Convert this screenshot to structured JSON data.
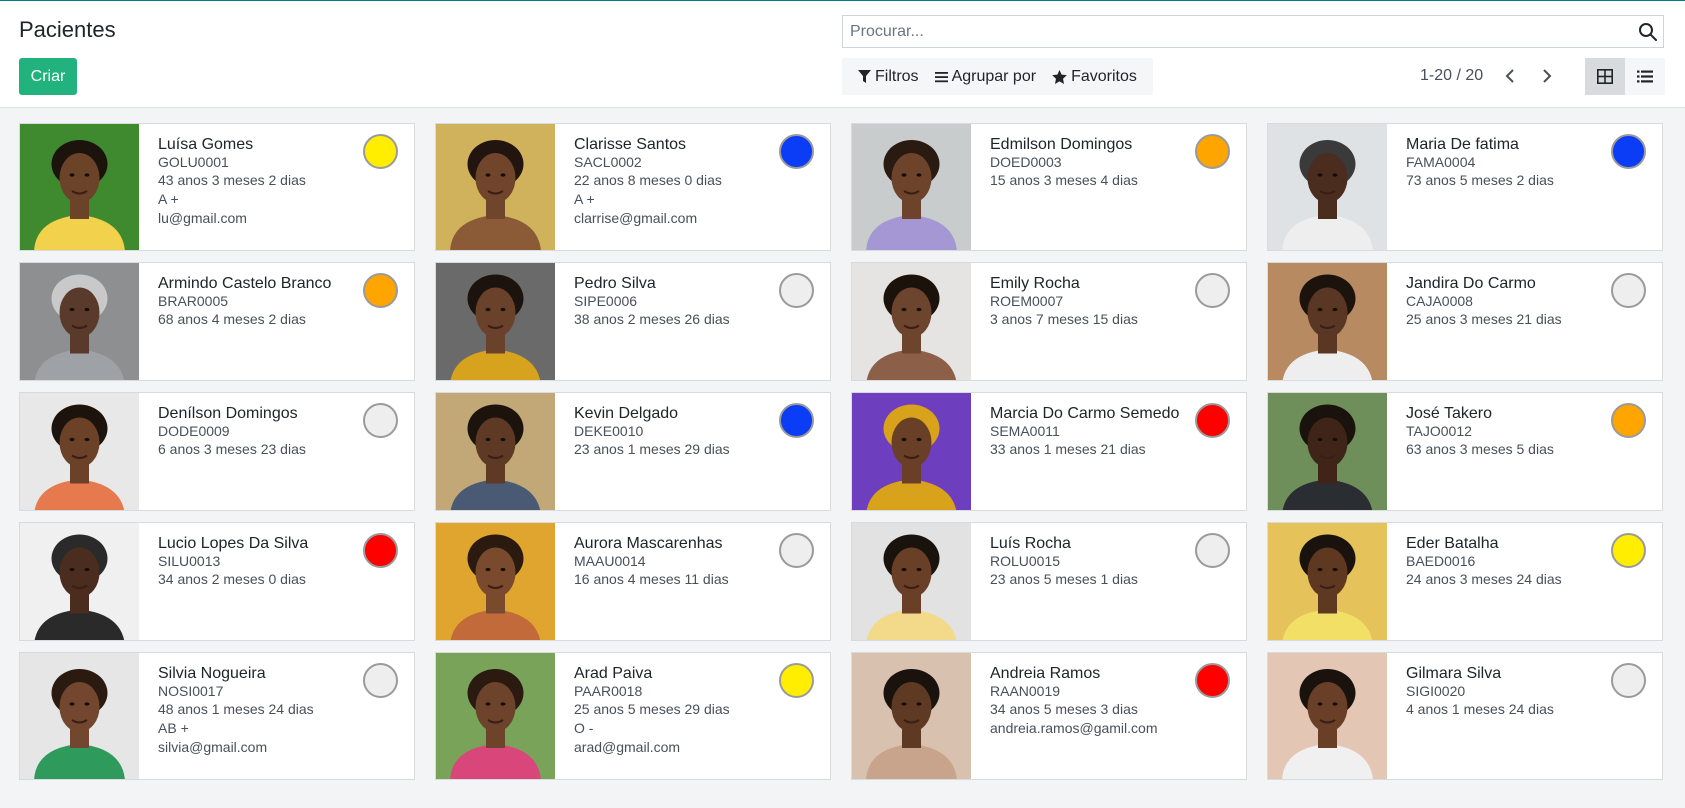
{
  "header": {
    "title": "Pacientes",
    "create_label": "Criar",
    "search_placeholder": "Procurar...",
    "filters_label": "Filtros",
    "group_label": "Agrupar por",
    "favorites_label": "Favoritos",
    "pager": "1-20 / 20",
    "view_modes": [
      "kanban",
      "list"
    ],
    "active_view": "kanban"
  },
  "colors": {
    "accent": "#21b27d",
    "topline": "#017e84",
    "dot_empty": "#eeeeee",
    "dot_yellow": "#ffee00",
    "dot_blue": "#0a3df5",
    "dot_orange": "#ffa500",
    "dot_red": "#ff0000"
  },
  "patients": [
    {
      "name": "Luísa Gomes",
      "code": "GOLU0001",
      "age": "43 anos 3 meses 2 dias",
      "blood": "A +",
      "email": "lu@gmail.com",
      "dot": "#ffee00",
      "skin": "#6b4328",
      "bg": "#3f8a2e",
      "shirt": "#f2d14c",
      "hair": "#1c130d"
    },
    {
      "name": "Clarisse Santos",
      "code": "SACL0002",
      "age": "22 anos 8 meses 0 dias",
      "blood": "A +",
      "email": "clarrise@gmail.com",
      "dot": "#0a3df5",
      "skin": "#70452b",
      "bg": "#d1b25c",
      "shirt": "#8a5b36",
      "hair": "#221510"
    },
    {
      "name": "Edmilson Domingos",
      "code": "DOED0003",
      "age": "15 anos 3 meses 4 dias",
      "blood": "",
      "email": "",
      "dot": "#ffa500",
      "skin": "#6e432b",
      "bg": "#c9cccc",
      "shirt": "#a597d3",
      "hair": "#2a1b12"
    },
    {
      "name": "Maria De fatima",
      "code": "FAMA0004",
      "age": "73 anos 5 meses 2 dias",
      "blood": "",
      "email": "",
      "dot": "#0a3df5",
      "skin": "#4a2d1f",
      "bg": "#dfe2e4",
      "shirt": "#eeeeee",
      "hair": "#3a3a3a"
    },
    {
      "name": "Armindo Castelo Branco",
      "code": "BRAR0005",
      "age": "68 anos 4 meses 2 dias",
      "blood": "",
      "email": "",
      "dot": "#ffa500",
      "skin": "#5a3a2a",
      "bg": "#8d8f91",
      "shirt": "#9ea2a6",
      "hair": "#c9c9c9"
    },
    {
      "name": "Pedro Silva",
      "code": "SIPE0006",
      "age": "38 anos 2 meses 26 dias",
      "blood": "",
      "email": "",
      "dot": "#eeeeee",
      "skin": "#6a412a",
      "bg": "#6a6a6a",
      "shirt": "#d7a31f",
      "hair": "#1b130d"
    },
    {
      "name": "Emily Rocha",
      "code": "ROEM0007",
      "age": "3 anos 7 meses 15 dias",
      "blood": "",
      "email": "",
      "dot": "#eeeeee",
      "skin": "#6d442d",
      "bg": "#e6e4e2",
      "shirt": "#8c6048",
      "hair": "#1b120c"
    },
    {
      "name": "Jandira Do Carmo",
      "code": "CAJA0008",
      "age": "25 anos 3 meses 21 dias",
      "blood": "",
      "email": "",
      "dot": "#eeeeee",
      "skin": "#5a3624",
      "bg": "#b78a62",
      "shirt": "#eeeeee",
      "hair": "#1c130d"
    },
    {
      "name": "Denílson Domingos",
      "code": "DODE0009",
      "age": "6 anos 3 meses 23 dias",
      "blood": "",
      "email": "",
      "dot": "#eeeeee",
      "skin": "#6b4128",
      "bg": "#e8e8e8",
      "shirt": "#e67a4e",
      "hair": "#1c130d"
    },
    {
      "name": "Kevin Delgado",
      "code": "DEKE0010",
      "age": "23 anos 1 meses 29 dias",
      "blood": "",
      "email": "",
      "dot": "#0a3df5",
      "skin": "#5e3a25",
      "bg": "#c2a876",
      "shirt": "#4a5a75",
      "hair": "#1c130d"
    },
    {
      "name": "Marcia Do Carmo Semedo",
      "code": "SEMA0011",
      "age": "33 anos 1 meses 21 dias",
      "blood": "",
      "email": "",
      "dot": "#ff0000",
      "skin": "#6a3f27",
      "bg": "#6d3fbf",
      "shirt": "#d8a21a",
      "hair": "#d8a21a"
    },
    {
      "name": "José Takero",
      "code": "TAJO0012",
      "age": "63 anos 3 meses 5 dias",
      "blood": "",
      "email": "",
      "dot": "#ffa500",
      "skin": "#3f2517",
      "bg": "#6f8f5a",
      "shirt": "#2a2e33",
      "hair": "#1a120c"
    },
    {
      "name": "Lucio Lopes Da Silva",
      "code": "SILU0013",
      "age": "34 anos 2 meses 0 dias",
      "blood": "",
      "email": "",
      "dot": "#ff0000",
      "skin": "#4a2d1e",
      "bg": "#f0f0f0",
      "shirt": "#2a2a2a",
      "hair": "#2a2a2a"
    },
    {
      "name": "Aurora Mascarenhas",
      "code": "MAAU0014",
      "age": "16 anos 4 meses 11 dias",
      "blood": "",
      "email": "",
      "dot": "#eeeeee",
      "skin": "#7a4a2f",
      "bg": "#e0a52e",
      "shirt": "#c26a3a",
      "hair": "#2a1a10"
    },
    {
      "name": "Luís Rocha",
      "code": "ROLU0015",
      "age": "23 anos 5 meses 1 dias",
      "blood": "",
      "email": "",
      "dot": "#eeeeee",
      "skin": "#6a3f27",
      "bg": "#e2e2e2",
      "shirt": "#f3d98a",
      "hair": "#1a120c"
    },
    {
      "name": "Eder Batalha",
      "code": "BAED0016",
      "age": "24 anos 3 meses 24 dias",
      "blood": "",
      "email": "",
      "dot": "#ffee00",
      "skin": "#5f3822",
      "bg": "#e6c25a",
      "shirt": "#f2e066",
      "hair": "#1a120c"
    },
    {
      "name": "Silvia Nogueira",
      "code": "NOSI0017",
      "age": "48 anos 1 meses 24 dias",
      "blood": "AB +",
      "email": "silvia@gmail.com",
      "dot": "#eeeeee",
      "skin": "#734630",
      "bg": "#e6e6e6",
      "shirt": "#2e9a5c",
      "hair": "#2a1a10"
    },
    {
      "name": "Arad Paiva",
      "code": "PAAR0018",
      "age": "25 anos 5 meses 29 dias",
      "blood": "O -",
      "email": "arad@gmail.com",
      "dot": "#ffee00",
      "skin": "#6d432b",
      "bg": "#7aa35a",
      "shirt": "#d8467a",
      "hair": "#2a1a10"
    },
    {
      "name": "Andreia Ramos",
      "code": "RAAN0019",
      "age": "34 anos 5 meses 3 dias",
      "blood": "",
      "email": "andreia.ramos@gamil.com",
      "dot": "#ff0000",
      "skin": "#5e3a25",
      "bg": "#d9c1b0",
      "shirt": "#c8a48d",
      "hair": "#1a120c"
    },
    {
      "name": "Gilmara Silva",
      "code": "SIGI0020",
      "age": "4 anos 1 meses 24 dias",
      "blood": "",
      "email": "",
      "dot": "#eeeeee",
      "skin": "#6a3f28",
      "bg": "#e3c7b4",
      "shirt": "#f0f0f0",
      "hair": "#1a120c"
    }
  ]
}
